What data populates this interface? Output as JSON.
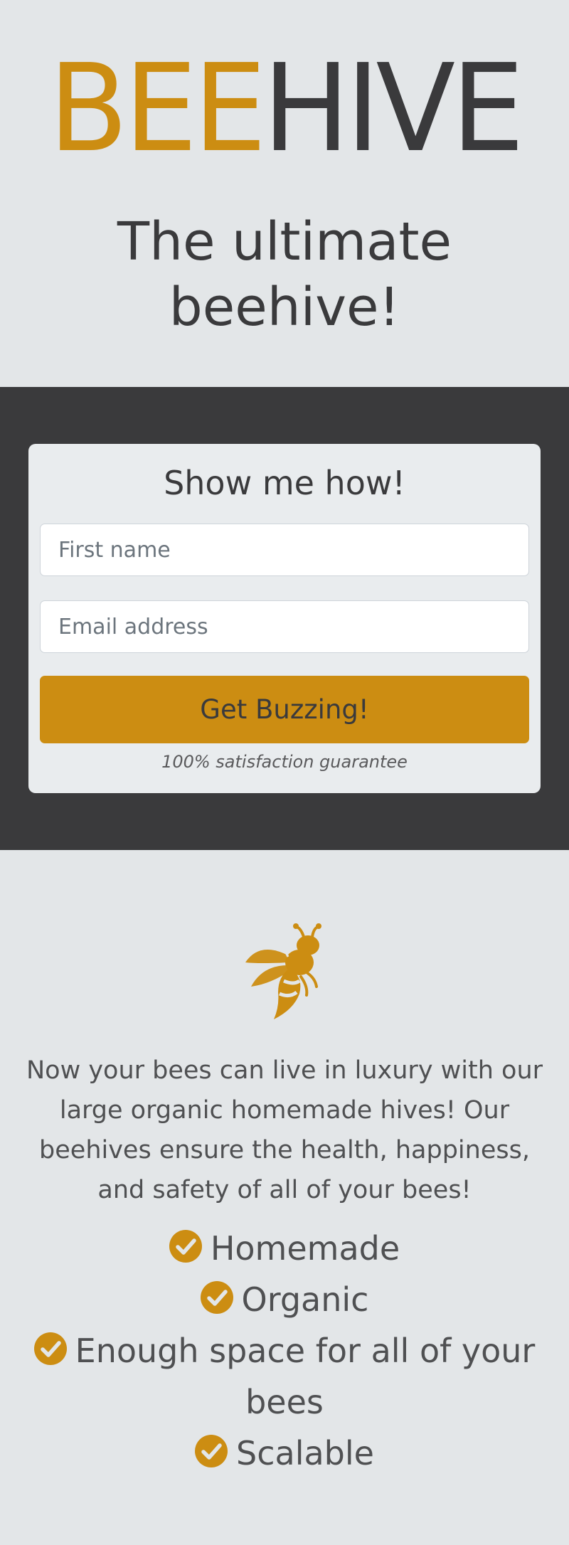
{
  "hero": {
    "logo_part1": "BEE",
    "logo_part2": "HIVE",
    "tagline": "The ultimate beehive!"
  },
  "signup": {
    "heading": "Show me how!",
    "first_name_placeholder": "First name",
    "email_placeholder": "Email address",
    "submit_label": "Get Buzzing!",
    "guarantee": "100% satisfaction guarantee"
  },
  "features": {
    "icon": "bee-icon",
    "description": "Now your bees can live in luxury with our large organic homemade hives! Our beehives ensure the health, happiness, and safety of all of your bees!",
    "items": [
      "Homemade",
      "Organic",
      "Enough space for all of your bees",
      "Scalable"
    ],
    "check_icon": "check-circle-icon"
  },
  "colors": {
    "accent": "#cc8d12",
    "dark": "#3a3a3c",
    "background": "#e3e6e8"
  }
}
